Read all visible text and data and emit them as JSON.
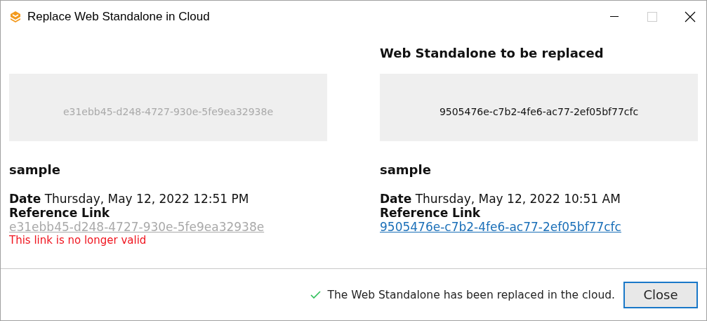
{
  "window": {
    "title": "Replace Web Standalone in Cloud"
  },
  "panels": [
    {
      "valid": false,
      "preview_id": "e31ebb45-d248-4727-930e-5fe9ea32938e",
      "name": "sample",
      "date_label": "Date",
      "date": "Thursday, May 12, 2022 12:51 PM",
      "link_label": "Reference Link",
      "link": "e31ebb45-d248-4727-930e-5fe9ea32938e",
      "error": "This link is no longer valid"
    },
    {
      "valid": true,
      "heading": "Web Standalone to be replaced",
      "preview_id": "9505476e-c7b2-4fe6-ac77-2ef05bf77cfc",
      "name": "sample",
      "date_label": "Date",
      "date": "Thursday, May 12, 2022 10:51 AM",
      "link_label": "Reference Link",
      "link": "9505476e-c7b2-4fe6-ac77-2ef05bf77cfc"
    }
  ],
  "status": {
    "message": "The Web Standalone has been replaced in the cloud."
  },
  "buttons": [
    "Close"
  ]
}
